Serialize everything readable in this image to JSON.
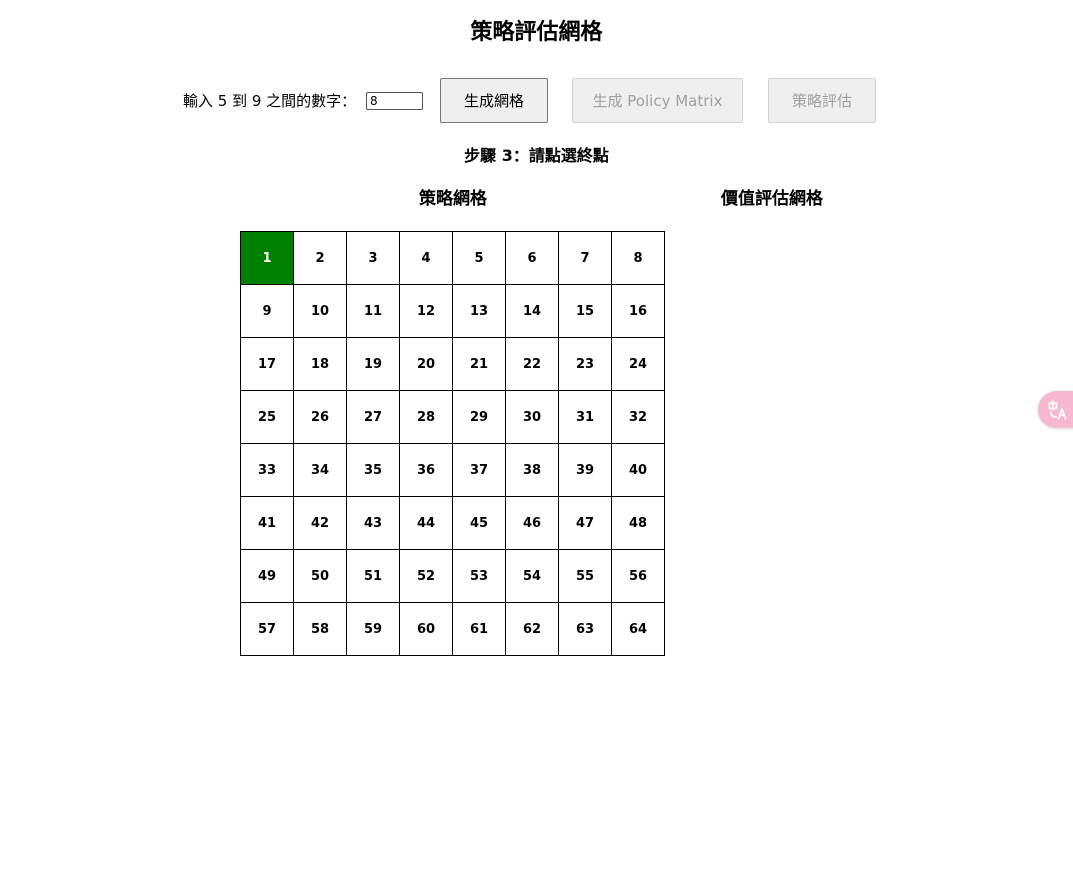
{
  "page": {
    "title": "策略評估網格"
  },
  "controls": {
    "size_label": "輸入 5 到 9 之間的數字：",
    "size_value": "8",
    "generate_grid_label": "生成網格",
    "generate_policy_label": "生成 Policy Matrix",
    "evaluate_label": "策略評估"
  },
  "status": {
    "step_text": "步驟 3：請點選終點"
  },
  "policy_grid": {
    "title": "策略網格",
    "size": 8,
    "start_cell": 1,
    "start_color": "#008000",
    "cells": [
      "1",
      "2",
      "3",
      "4",
      "5",
      "6",
      "7",
      "8",
      "9",
      "10",
      "11",
      "12",
      "13",
      "14",
      "15",
      "16",
      "17",
      "18",
      "19",
      "20",
      "21",
      "22",
      "23",
      "24",
      "25",
      "26",
      "27",
      "28",
      "29",
      "30",
      "31",
      "32",
      "33",
      "34",
      "35",
      "36",
      "37",
      "38",
      "39",
      "40",
      "41",
      "42",
      "43",
      "44",
      "45",
      "46",
      "47",
      "48",
      "49",
      "50",
      "51",
      "52",
      "53",
      "54",
      "55",
      "56",
      "57",
      "58",
      "59",
      "60",
      "61",
      "62",
      "63",
      "64"
    ]
  },
  "value_grid": {
    "title": "價值評估網格"
  },
  "widgets": {
    "translate_icon": "translate-icon",
    "translate_color": "#f6b7cf"
  }
}
